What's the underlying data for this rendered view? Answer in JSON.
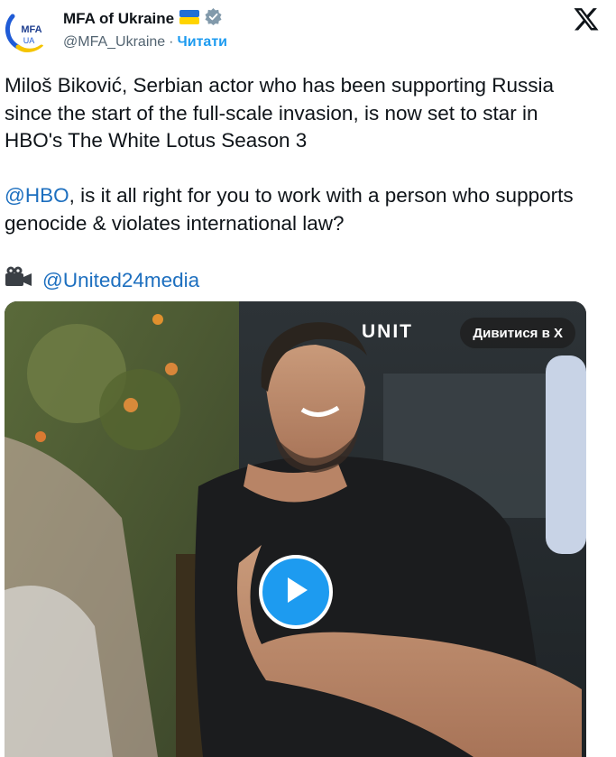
{
  "header": {
    "display_name": "MFA of Ukraine",
    "handle": "@MFA_Ukraine",
    "separator": "·",
    "follow_label": "Читати",
    "avatar_text_top": "MFA",
    "avatar_text_bottom": "UA"
  },
  "tweet": {
    "paragraph1": "Miloš Biković, Serbian actor who has been supporting Russia since the start of the full-scale invasion, is now set to star in HBO's The White Lotus Season 3",
    "mention_hbo": "@HBO",
    "paragraph2_rest": ", is it all right for you to work with a person who supports genocide & violates international law?",
    "camera_emoji": "🎥",
    "mention_united24": "@United24media"
  },
  "media": {
    "watch_label": "Дивитися в X",
    "watermark": "UNIT"
  },
  "colors": {
    "link": "#1d9bf0",
    "mention": "#1d6fbf",
    "play_button": "#1d9bf0"
  },
  "icons": [
    "verified-badge-icon",
    "ukraine-flag-icon",
    "x-logo-icon",
    "video-camera-icon",
    "play-icon"
  ]
}
